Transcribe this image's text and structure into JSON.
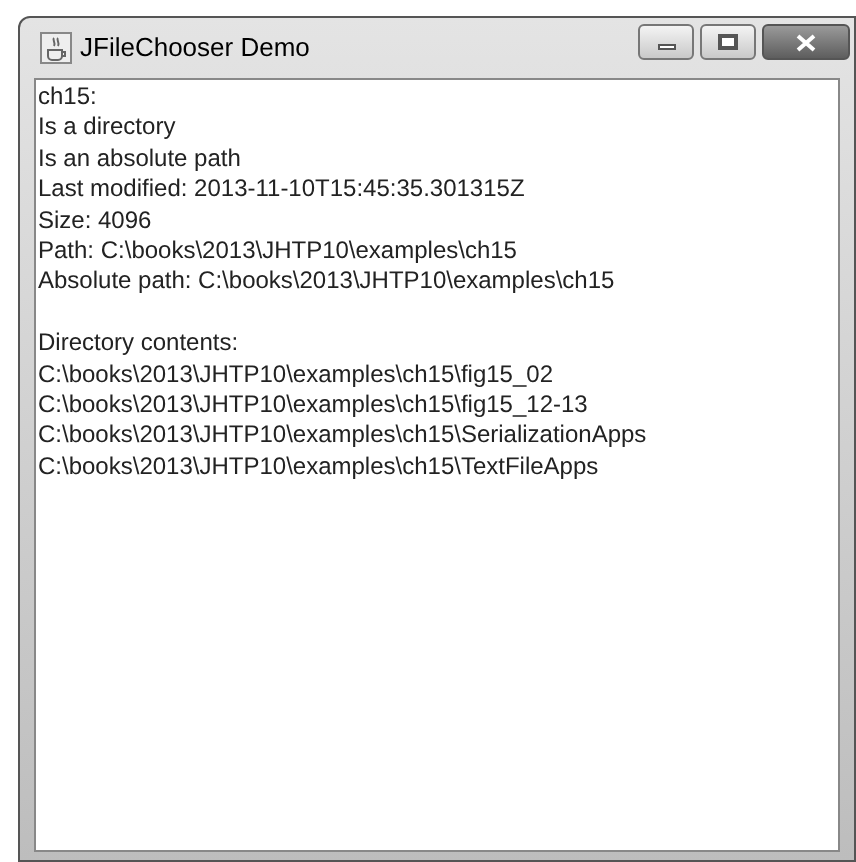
{
  "window": {
    "title": "JFileChooser Demo"
  },
  "text_area": {
    "blocks": [
      [
        "ch15:",
        "Is a directory",
        "Is an absolute path",
        "Last modified: 2013-11-10T15:45:35.301315Z",
        "Size: 4096",
        "Path: C:\\books\\2013\\JHTP10\\examples\\ch15",
        "Absolute path: C:\\books\\2013\\JHTP10\\examples\\ch15"
      ],
      [
        "Directory contents:",
        "C:\\books\\2013\\JHTP10\\examples\\ch15\\fig15_02",
        "C:\\books\\2013\\JHTP10\\examples\\ch15\\fig15_12-13",
        "C:\\books\\2013\\JHTP10\\examples\\ch15\\SerializationApps",
        "C:\\books\\2013\\JHTP10\\examples\\ch15\\TextFileApps"
      ]
    ]
  }
}
